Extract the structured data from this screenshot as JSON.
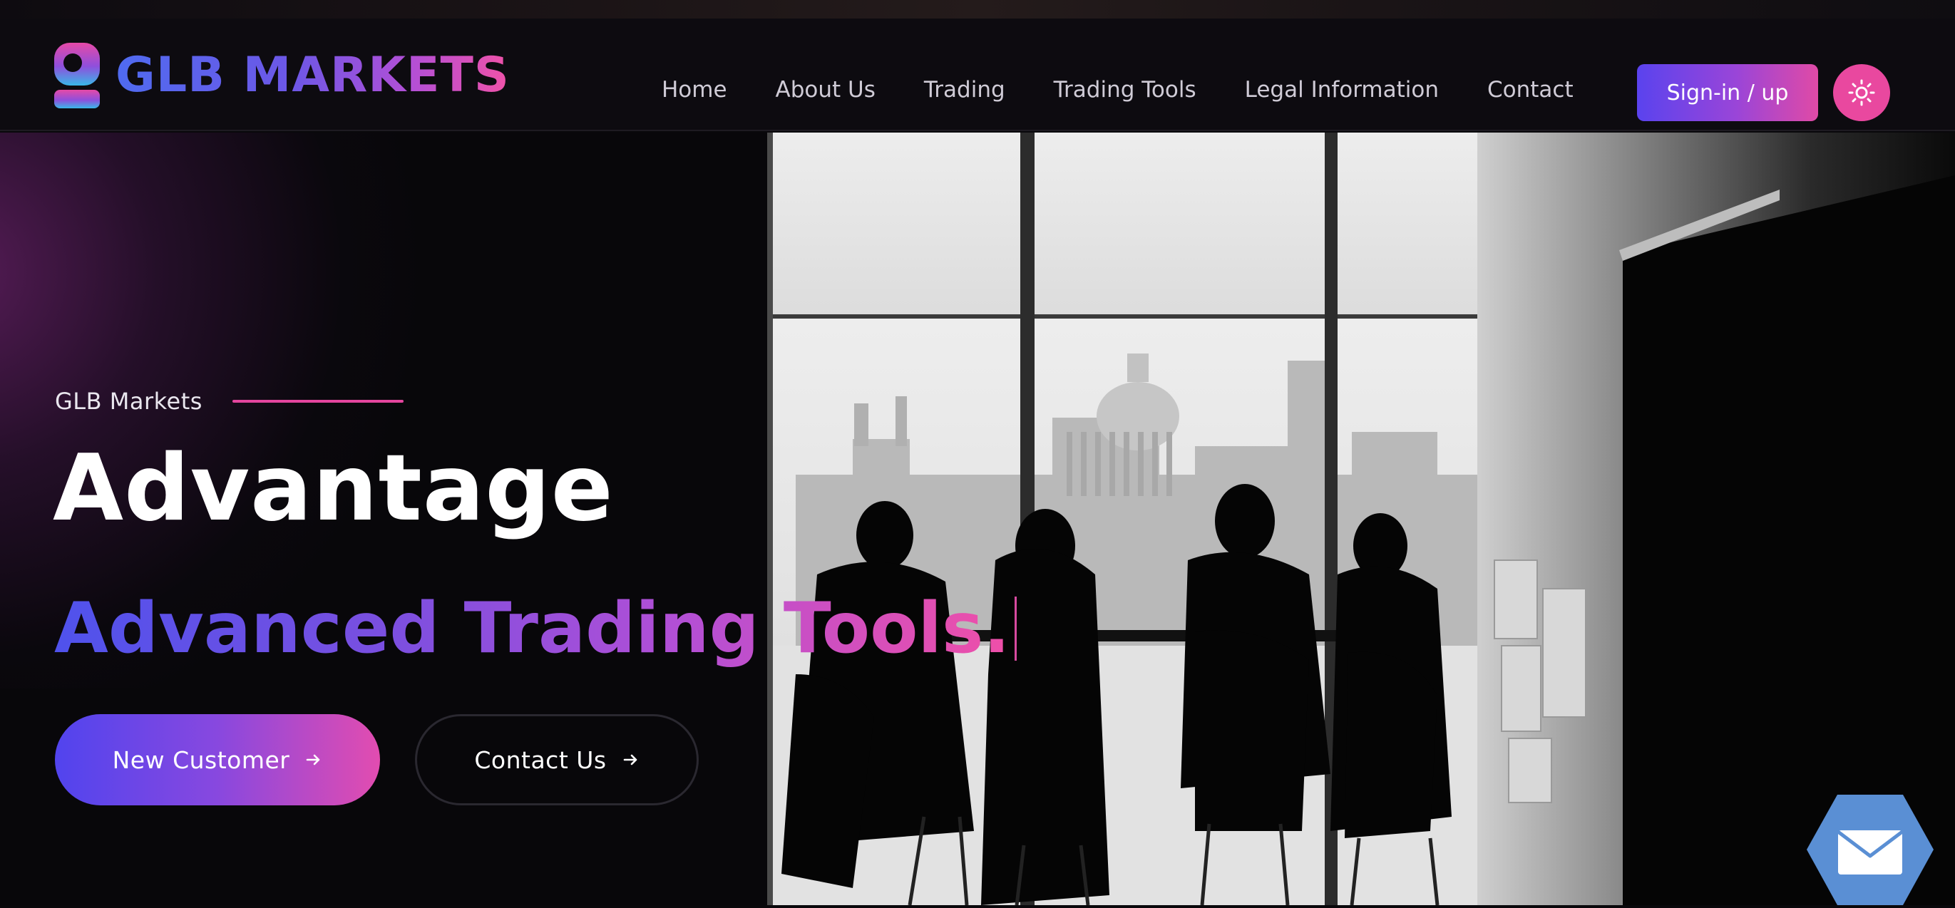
{
  "brand": {
    "name": "GLB Markets",
    "logo_text": "GLB MARKETS",
    "logo_icon": "glb-logo-mark",
    "gradient": [
      "#4f6bf0",
      "#b34fd6",
      "#f052a8"
    ]
  },
  "nav": {
    "items": [
      {
        "label": "Home"
      },
      {
        "label": "About Us"
      },
      {
        "label": "Trading"
      },
      {
        "label": "Trading Tools"
      },
      {
        "label": "Legal Information"
      },
      {
        "label": "Contact"
      }
    ],
    "signin_label": "Sign-in / up",
    "theme_icon": "sun-icon"
  },
  "hero": {
    "eyebrow": "GLB Markets",
    "title": "Advantage",
    "subtitle": "Advanced Trading Tools.",
    "primary_button": {
      "label": "New Customer",
      "icon": "arrow-right-icon"
    },
    "secondary_button": {
      "label": "Contact Us",
      "icon": "arrow-right-icon"
    },
    "image": "team-meeting-city-window-photo"
  },
  "floating": {
    "mail_icon": "mail-icon"
  },
  "colors": {
    "accent_pink": "#e9489f",
    "accent_indigo": "#5144ee",
    "background": "#08070a",
    "mail_fab": "#5a8fd4"
  }
}
